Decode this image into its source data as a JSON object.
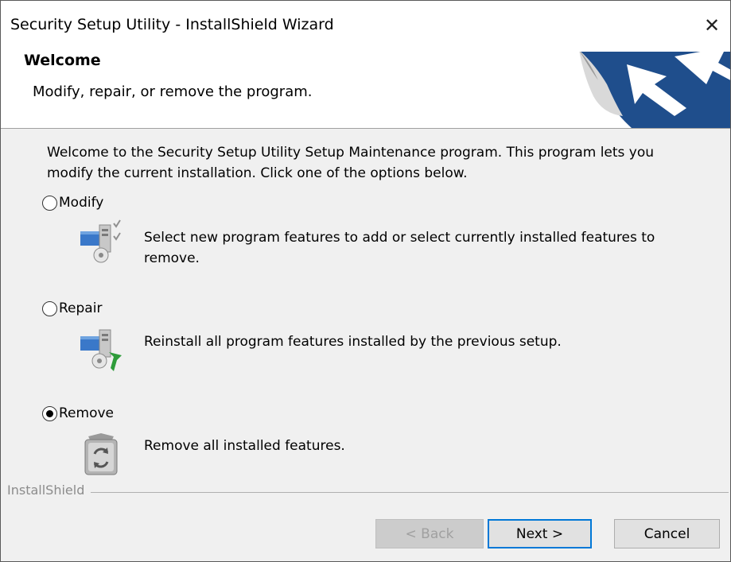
{
  "window": {
    "title": "Security Setup Utility - InstallShield Wizard"
  },
  "header": {
    "title": "Welcome",
    "subtitle": "Modify, repair, or remove the program."
  },
  "intro_text": "Welcome to the Security Setup Utility Setup Maintenance program. This program lets you modify the current installation. Click one of the options below.",
  "options": [
    {
      "label": "Modify",
      "description": "Select new program features to add or select currently installed features to remove.",
      "selected": false,
      "icon": "modify-features-icon"
    },
    {
      "label": "Repair",
      "description": "Reinstall all program features installed by the previous setup.",
      "selected": false,
      "icon": "repair-tools-icon"
    },
    {
      "label": "Remove",
      "description": "Remove all installed features.",
      "selected": true,
      "icon": "recycle-bin-icon"
    }
  ],
  "brand": "InstallShield",
  "buttons": {
    "back": "< Back",
    "next": "Next >",
    "cancel": "Cancel"
  },
  "colors": {
    "logo_blue": "#1f4e8c",
    "default_button_border": "#0078d7"
  }
}
